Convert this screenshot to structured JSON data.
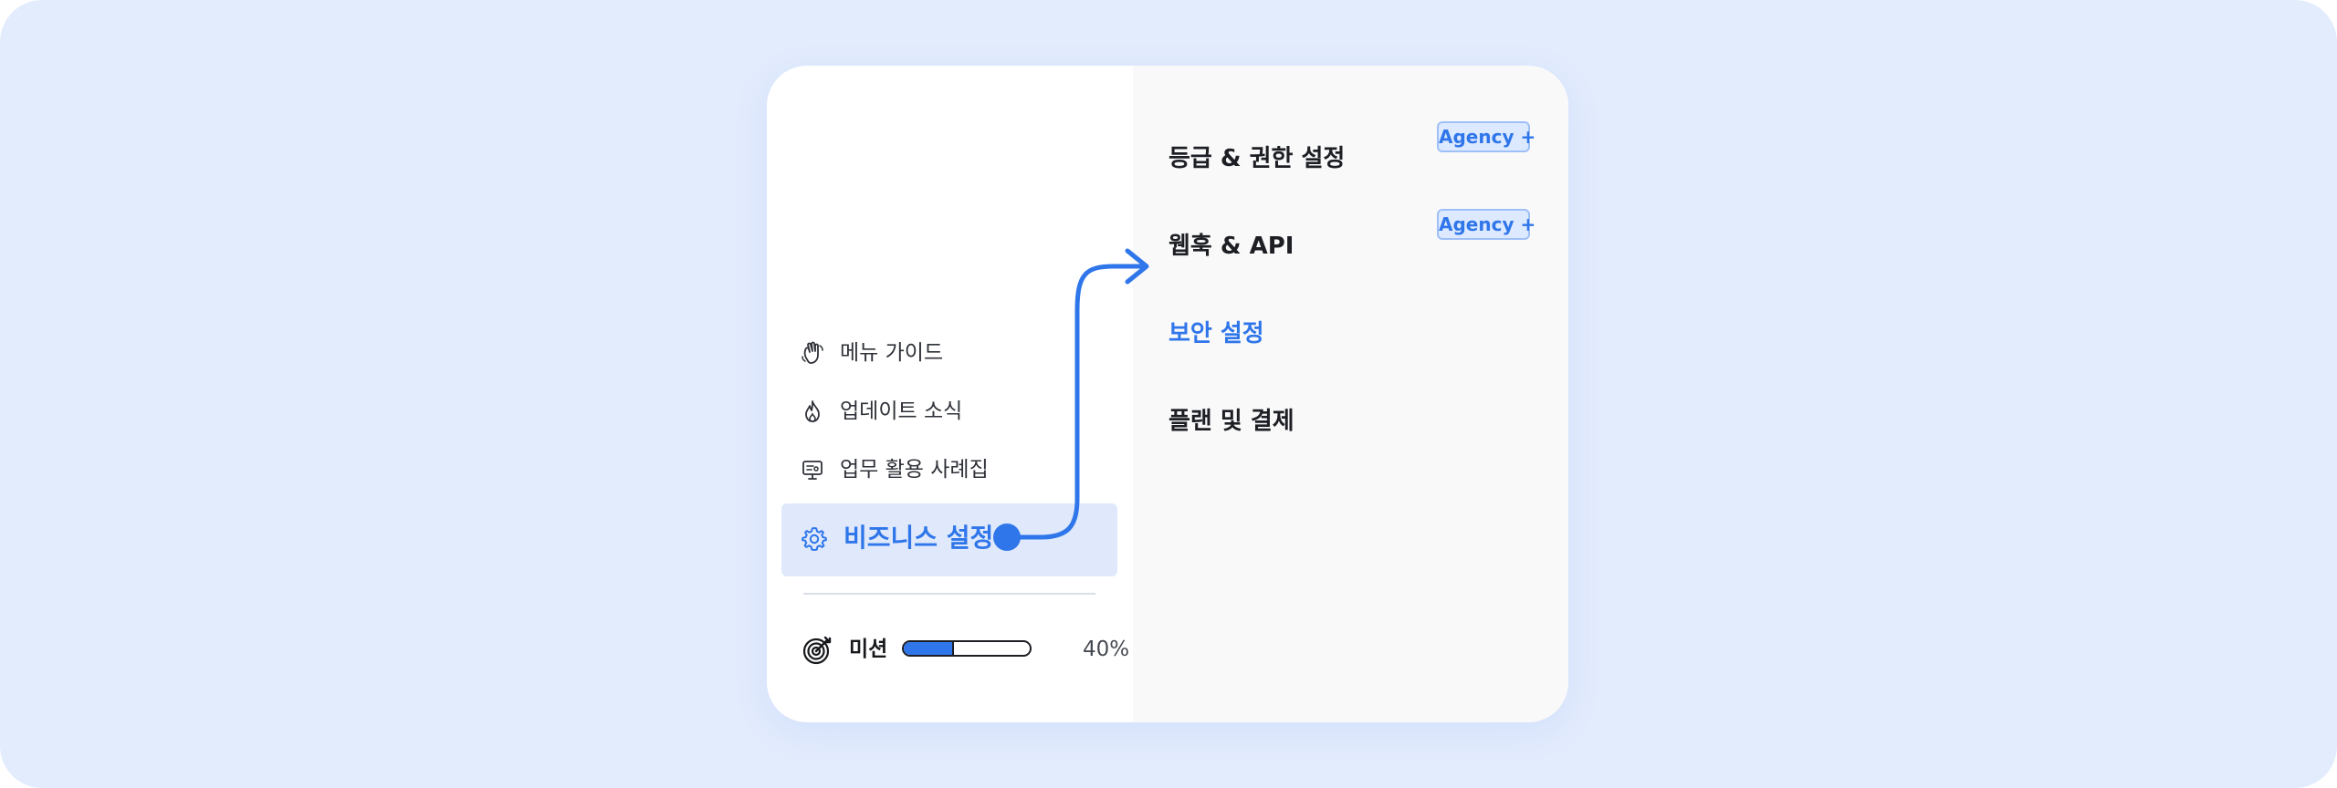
{
  "left_menu": {
    "items": [
      {
        "label": "메뉴 가이드",
        "icon": "waving-hand-icon"
      },
      {
        "label": "업데이트 소식",
        "icon": "flame-icon"
      },
      {
        "label": "업무 활용 사례집",
        "icon": "presentation-icon"
      }
    ],
    "active": {
      "label": "비즈니스 설정",
      "icon": "gear-icon"
    },
    "mission": {
      "label": "미션",
      "progress": 40,
      "progress_text": "40%",
      "icon": "target-icon"
    }
  },
  "right_menu": {
    "items": [
      {
        "label": "등급 & 권한 설정",
        "badge": "Agency +",
        "active": false
      },
      {
        "label": "웹훅 & API",
        "badge": "Agency +",
        "active": false
      },
      {
        "label": "보안 설정",
        "badge": "",
        "active": true
      },
      {
        "label": "플랜 및 결제",
        "badge": "",
        "active": false
      }
    ]
  },
  "colors": {
    "background": "#e3ecfd",
    "accent": "#2f76ea",
    "active_row": "#dfe9fb",
    "badge_background": "#dce9ff",
    "badge_border": "#9fc0f7"
  }
}
